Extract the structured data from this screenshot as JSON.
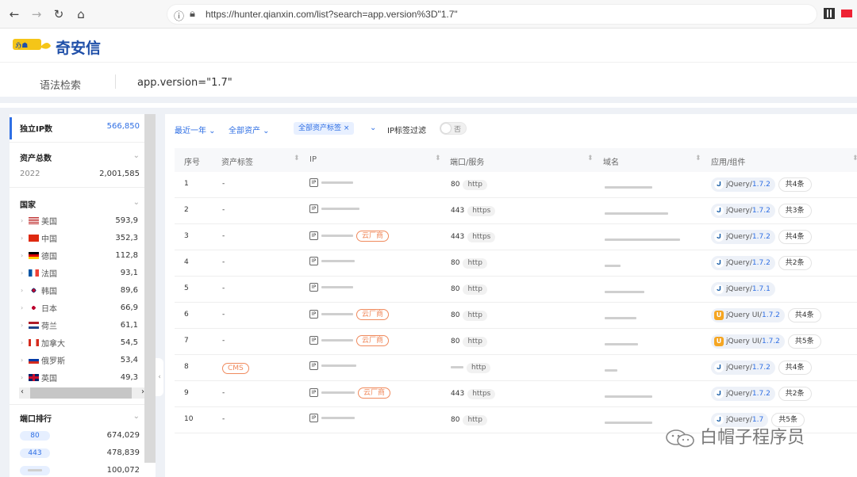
{
  "browser": {
    "url": "https://hunter.qianxin.com/list?search=app.version%3D\"1.7\""
  },
  "header": {
    "logo_text": "奇安信"
  },
  "search": {
    "label": "语法检索",
    "query": "app.version=\"1.7\""
  },
  "sidebar": {
    "unique_ip": {
      "label": "独立IP数",
      "value": "566,850"
    },
    "asset_total": {
      "label": "资产总数",
      "year": "2022",
      "value": "2,001,585"
    },
    "country": {
      "label": "国家",
      "items": [
        {
          "name": "美国",
          "count": "593,9"
        },
        {
          "name": "中国",
          "count": "352,3"
        },
        {
          "name": "德国",
          "count": "112,8"
        },
        {
          "name": "法国",
          "count": "93,1"
        },
        {
          "name": "韩国",
          "count": "89,6"
        },
        {
          "name": "日本",
          "count": "66,9"
        },
        {
          "name": "荷兰",
          "count": "61,1"
        },
        {
          "name": "加拿大",
          "count": "54,5"
        },
        {
          "name": "俄罗斯",
          "count": "53,4"
        },
        {
          "name": "英国",
          "count": "49,3"
        }
      ]
    },
    "ports": {
      "label": "端口排行",
      "items": [
        {
          "port": "80",
          "count": "674,029"
        },
        {
          "port": "443",
          "count": "478,839"
        },
        {
          "port": "",
          "count": "100,072"
        }
      ]
    }
  },
  "filters": {
    "time": "最近一年",
    "assets": "全部资产",
    "tag_chip": "全部资产标签",
    "ip_tag_filter": "IP标签过滤",
    "toggle_label": "否"
  },
  "table": {
    "headers": [
      "序号",
      "资产标签",
      "IP",
      "端口/服务",
      "域名",
      "应用/组件"
    ],
    "rows": [
      {
        "no": "1",
        "tag": "-",
        "cloud": "",
        "port": "80",
        "service": "http",
        "app_type": "jquery",
        "app": "jQuery/",
        "ver": "1.7.2",
        "more": "共4条"
      },
      {
        "no": "2",
        "tag": "-",
        "cloud": "",
        "port": "443",
        "service": "https",
        "app_type": "jquery",
        "app": "jQuery/",
        "ver": "1.7.2",
        "more": "共3条"
      },
      {
        "no": "3",
        "tag": "-",
        "cloud": "云厂商",
        "port": "443",
        "service": "https",
        "app_type": "jquery",
        "app": "jQuery/",
        "ver": "1.7.2",
        "more": "共4条"
      },
      {
        "no": "4",
        "tag": "-",
        "cloud": "",
        "port": "80",
        "service": "http",
        "app_type": "jquery",
        "app": "jQuery/",
        "ver": "1.7.2",
        "more": "共2条"
      },
      {
        "no": "5",
        "tag": "-",
        "cloud": "",
        "port": "80",
        "service": "http",
        "app_type": "jquery",
        "app": "jQuery/",
        "ver": "1.7.1",
        "more": ""
      },
      {
        "no": "6",
        "tag": "-",
        "cloud": "云厂商",
        "port": "80",
        "service": "http",
        "app_type": "jqueryui",
        "app": "jQuery UI/",
        "ver": "1.7.2",
        "more": "共4条"
      },
      {
        "no": "7",
        "tag": "-",
        "cloud": "云厂商",
        "port": "80",
        "service": "http",
        "app_type": "jqueryui",
        "app": "jQuery UI/",
        "ver": "1.7.2",
        "more": "共5条"
      },
      {
        "no": "8",
        "tag": "CMS",
        "cloud": "",
        "port": "",
        "service": "http",
        "app_type": "jquery",
        "app": "jQuery/",
        "ver": "1.7.2",
        "more": "共4条"
      },
      {
        "no": "9",
        "tag": "-",
        "cloud": "云厂商",
        "port": "443",
        "service": "https",
        "app_type": "jquery",
        "app": "jQuery/",
        "ver": "1.7.2",
        "more": "共2条"
      },
      {
        "no": "10",
        "tag": "-",
        "cloud": "",
        "port": "80",
        "service": "http",
        "app_type": "jquery",
        "app": "jQuery/",
        "ver": "1.7",
        "more": "共5条"
      }
    ]
  },
  "watermark": "白帽子程序员",
  "colors": {
    "accent": "#2f6fe4",
    "cloud_tag": "#f08a5d",
    "logo": "#1f4fa8"
  }
}
